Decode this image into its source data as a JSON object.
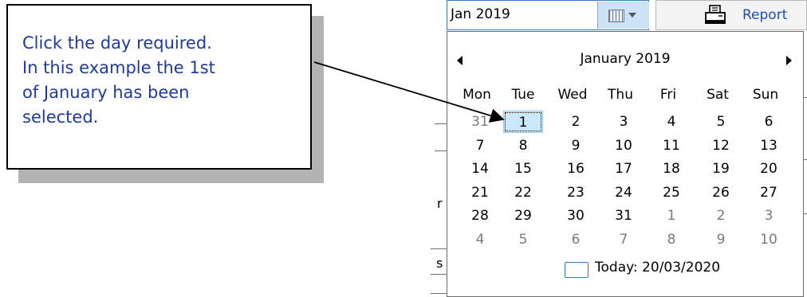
{
  "callout": {
    "text": "Click the day required. In this example the 1st of January has been selected."
  },
  "date_input": {
    "value": "Jan 2019"
  },
  "toolbar": {
    "calendar_dropdown_icon": "calendar-dropdown-icon",
    "report_label": "Report",
    "report_icon": "printer-icon"
  },
  "background_fragments": {
    "r_text": "r",
    "s_text": "s"
  },
  "calendar": {
    "month_title": "January 2019",
    "weekdays": [
      "Mon",
      "Tue",
      "Wed",
      "Thu",
      "Fri",
      "Sat",
      "Sun"
    ],
    "weeks": [
      [
        "31",
        "1",
        "2",
        "3",
        "4",
        "5",
        "6"
      ],
      [
        "7",
        "8",
        "9",
        "10",
        "11",
        "12",
        "13"
      ],
      [
        "14",
        "15",
        "16",
        "17",
        "18",
        "19",
        "20"
      ],
      [
        "21",
        "22",
        "23",
        "24",
        "25",
        "26",
        "27"
      ],
      [
        "28",
        "29",
        "30",
        "31",
        "1",
        "2",
        "3"
      ],
      [
        "4",
        "5",
        "6",
        "7",
        "8",
        "9",
        "10"
      ]
    ],
    "selected_day": "1",
    "today_label": "Today: 20/03/2020"
  },
  "colors": {
    "callout_text": "#1f3a9a",
    "report_link": "#1b49c9",
    "selection_fill": "#cce8ff",
    "today_border": "#2a78d6"
  }
}
